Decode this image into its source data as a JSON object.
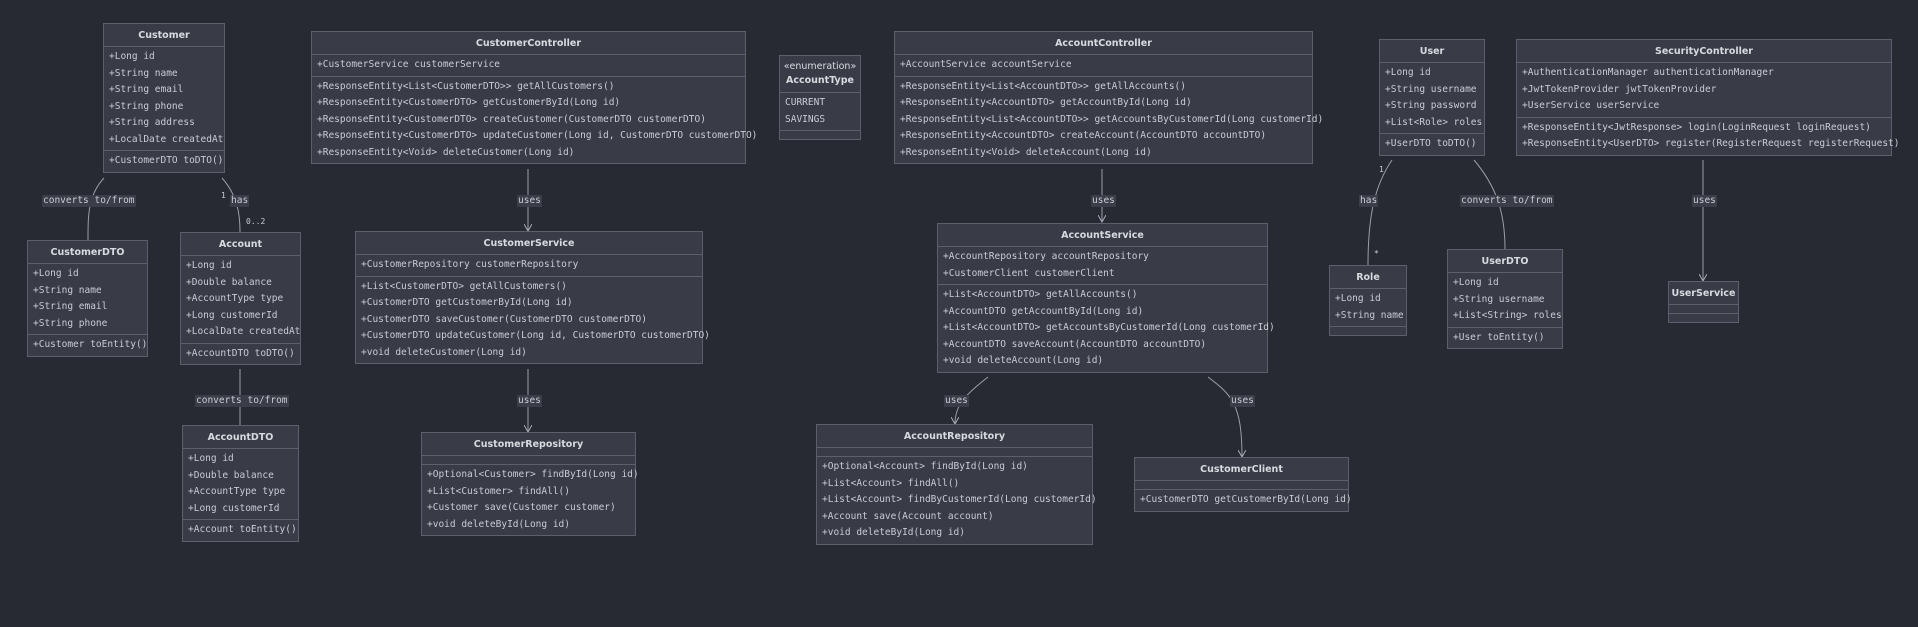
{
  "classes": {
    "customer": {
      "name": "Customer",
      "fields": [
        "+Long id",
        "+String name",
        "+String email",
        "+String phone",
        "+String address",
        "+LocalDate createdAt"
      ],
      "methods": [
        "+CustomerDTO toDTO()"
      ]
    },
    "customer_dto": {
      "name": "CustomerDTO",
      "fields": [
        "+Long id",
        "+String name",
        "+String email",
        "+String phone"
      ],
      "methods": [
        "+Customer toEntity()"
      ]
    },
    "account": {
      "name": "Account",
      "fields": [
        "+Long id",
        "+Double balance",
        "+AccountType type",
        "+Long customerId",
        "+LocalDate createdAt"
      ],
      "methods": [
        "+AccountDTO toDTO()"
      ]
    },
    "account_dto": {
      "name": "AccountDTO",
      "fields": [
        "+Long id",
        "+Double balance",
        "+AccountType type",
        "+Long customerId"
      ],
      "methods": [
        "+Account toEntity()"
      ]
    },
    "customer_controller": {
      "name": "CustomerController",
      "fields": [
        "+CustomerService customerService"
      ],
      "methods": [
        "+ResponseEntity<List<CustomerDTO>> getAllCustomers()",
        "+ResponseEntity<CustomerDTO> getCustomerById(Long id)",
        "+ResponseEntity<CustomerDTO> createCustomer(CustomerDTO customerDTO)",
        "+ResponseEntity<CustomerDTO> updateCustomer(Long id, CustomerDTO customerDTO)",
        "+ResponseEntity<Void> deleteCustomer(Long id)"
      ]
    },
    "customer_service": {
      "name": "CustomerService",
      "fields": [
        "+CustomerRepository customerRepository"
      ],
      "methods": [
        "+List<CustomerDTO> getAllCustomers()",
        "+CustomerDTO getCustomerById(Long id)",
        "+CustomerDTO saveCustomer(CustomerDTO customerDTO)",
        "+CustomerDTO updateCustomer(Long id, CustomerDTO customerDTO)",
        "+void deleteCustomer(Long id)"
      ]
    },
    "customer_repository": {
      "name": "CustomerRepository",
      "fields": [],
      "methods": [
        "+Optional<Customer> findById(Long id)",
        "+List<Customer> findAll()",
        "+Customer save(Customer customer)",
        "+void deleteById(Long id)"
      ]
    },
    "account_type": {
      "stereotype": "«enumeration»",
      "name": "AccountType",
      "fields": [
        "CURRENT",
        "SAVINGS"
      ],
      "methods": []
    },
    "account_controller": {
      "name": "AccountController",
      "fields": [
        "+AccountService accountService"
      ],
      "methods": [
        "+ResponseEntity<List<AccountDTO>> getAllAccounts()",
        "+ResponseEntity<AccountDTO> getAccountById(Long id)",
        "+ResponseEntity<List<AccountDTO>> getAccountsByCustomerId(Long customerId)",
        "+ResponseEntity<AccountDTO> createAccount(AccountDTO accountDTO)",
        "+ResponseEntity<Void> deleteAccount(Long id)"
      ]
    },
    "account_service": {
      "name": "AccountService",
      "fields": [
        "+AccountRepository accountRepository",
        "+CustomerClient customerClient"
      ],
      "methods": [
        "+List<AccountDTO> getAllAccounts()",
        "+AccountDTO getAccountById(Long id)",
        "+List<AccountDTO> getAccountsByCustomerId(Long customerId)",
        "+AccountDTO saveAccount(AccountDTO accountDTO)",
        "+void deleteAccount(Long id)"
      ]
    },
    "account_repository": {
      "name": "AccountRepository",
      "fields": [],
      "methods": [
        "+Optional<Account> findById(Long id)",
        "+List<Account> findAll()",
        "+List<Account> findByCustomerId(Long customerId)",
        "+Account save(Account account)",
        "+void deleteById(Long id)"
      ]
    },
    "customer_client": {
      "name": "CustomerClient",
      "fields": [],
      "methods": [
        "+CustomerDTO getCustomerById(Long id)"
      ]
    },
    "user": {
      "name": "User",
      "fields": [
        "+Long id",
        "+String username",
        "+String password",
        "+List<Role> roles"
      ],
      "methods": [
        "+UserDTO toDTO()"
      ]
    },
    "role": {
      "name": "Role",
      "fields": [
        "+Long id",
        "+String name"
      ],
      "methods": []
    },
    "user_dto": {
      "name": "UserDTO",
      "fields": [
        "+Long id",
        "+String username",
        "+List<String> roles"
      ],
      "methods": [
        "+User toEntity()"
      ]
    },
    "security_controller": {
      "name": "SecurityController",
      "fields": [
        "+AuthenticationManager authenticationManager",
        "+JwtTokenProvider jwtTokenProvider",
        "+UserService userService"
      ],
      "methods": [
        "+ResponseEntity<JwtResponse> login(LoginRequest loginRequest)",
        "+ResponseEntity<UserDTO> register(RegisterRequest registerRequest)"
      ]
    },
    "user_service": {
      "name": "UserService",
      "fields": [],
      "methods": []
    }
  },
  "relations": {
    "customer_dto": "converts to/from",
    "customer_account": "has",
    "customer_account_m1": "1",
    "customer_account_m2": "0..2",
    "account_dto": "converts to/from",
    "cc_cs": "uses",
    "cs_cr": "uses",
    "ac_as": "uses",
    "as_ar": "uses",
    "as_cl": "uses",
    "user_role": "has",
    "user_role_m1": "1",
    "user_role_m2": "*",
    "user_dto": "converts to/from",
    "sc_us": "uses"
  }
}
